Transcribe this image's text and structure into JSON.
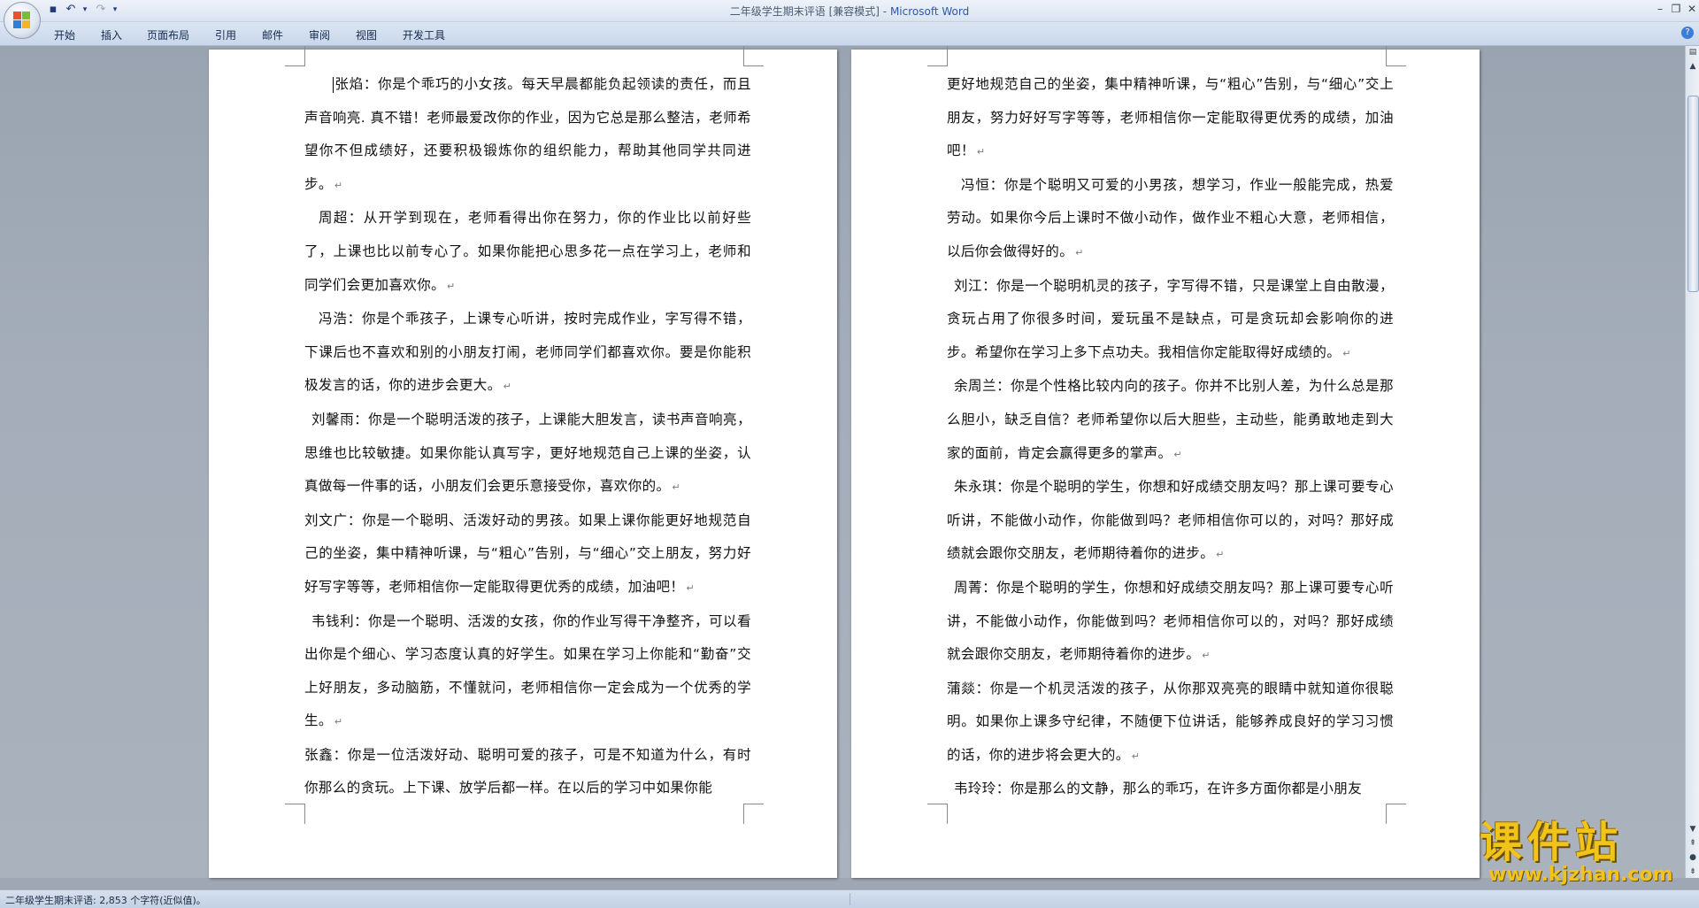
{
  "window": {
    "title": "二年级学生期末评语 [兼容模式]",
    "separator": " - ",
    "app": "Microsoft Word"
  },
  "ribbon": {
    "tabs": [
      "开始",
      "插入",
      "页面布局",
      "引用",
      "邮件",
      "审阅",
      "视图",
      "开发工具"
    ]
  },
  "document": {
    "left_page": [
      "张焰：你是个乖巧的小女孩。每天早晨都能负起领读的责任，而且声音响亮. 真不错！老师最爱改你的作业，因为它总是那么整洁，老师希望你不但成绩好，还要积极锻炼你的组织能力，帮助其他同学共同进步。",
      "周超：从开学到现在，老师看得出你在努力，你的作业比以前好些了，上课也比以前专心了。如果你能把心思多花一点在学习上，老师和同学们会更加喜欢你。",
      "冯浩：你是个乖孩子，上课专心听讲，按时完成作业，字写得不错，下课后也不喜欢和别的小朋友打闹，老师同学们都喜欢你。要是你能积极发言的话，你的进步会更大。",
      "刘馨雨：你是一个聪明活泼的孩子，上课能大胆发言，读书声音响亮，思维也比较敏捷。如果你能认真写字，更好地规范自己上课的坐姿，认真做每一件事的话，小朋友们会更乐意接受你，喜欢你的。",
      "刘文广：你是一个聪明、活泼好动的男孩。如果上课你能更好地规范自己的坐姿，集中精神听课，与“粗心”告别，与“细心”交上朋友，努力好好写字等等，老师相信你一定能取得更优秀的成绩，加油吧！",
      "韦钱利：你是一个聪明、活泼的女孩，你的作业写得干净整齐，可以看出你是个细心、学习态度认真的好学生。如果在学习上你能和“勤奋”交上好朋友，多动脑筋，不懂就问，老师相信你一定会成为一个优秀的学生。",
      "张鑫：你是一位活泼好动、聪明可爱的孩子，可是不知道为什么，有时你那么的贪玩。上下课、放学后都一样。在以后的学习中如果你能"
    ],
    "right_page": [
      "更好地规范自己的坐姿，集中精神听课，与“粗心”告别，与“细心”交上朋友，努力好好写字等等，老师相信你一定能取得更优秀的成绩，加油吧！",
      "冯恒：你是个聪明又可爱的小男孩，想学习，作业一般能完成，热爱劳动。如果你今后上课时不做小动作，做作业不粗心大意，老师相信，以后你会做得好的。",
      "刘江：你是一个聪明机灵的孩子，字写得不错，只是课堂上自由散漫，贪玩占用了你很多时间，爱玩虽不是缺点，可是贪玩却会影响你的进步。希望你在学习上多下点功夫。我相信你定能取得好成绩的。",
      "余周兰：你是个性格比较内向的孩子。你并不比别人差，为什么总是那么胆小，缺乏自信？老师希望你以后大胆些，主动些，能勇敢地走到大家的面前，肯定会赢得更多的掌声。",
      "朱永琪：你是个聪明的学生，你想和好成绩交朋友吗？那上课可要专心听讲，不能做小动作，你能做到吗？老师相信你可以的，对吗？那好成绩就会跟你交朋友，老师期待着你的进步。",
      "周菁：你是个聪明的学生，你想和好成绩交朋友吗？那上课可要专心听讲，不能做小动作，你能做到吗？老师相信你可以的，对吗？那好成绩就会跟你交朋友，老师期待着你的进步。",
      "蒲燚：你是一个机灵活泼的孩子，从你那双亮亮的眼睛中就知道你很聪明。如果你上课多守纪律，不随便下位讲话，能够养成良好的学习习惯的话，你的进步将会更大的。",
      "韦玲玲：你是那么的文静，那么的乖巧，在许多方面你都是小朋友"
    ],
    "paragraph_mark": "↵"
  },
  "status": {
    "text": "二年级学生期末评语: 2,853 个字符(近似值)。"
  },
  "watermark": {
    "big": "课件站",
    "small": "www.kjzhan.com"
  },
  "colors": {
    "workspace": "#9ea7b3",
    "ribbon": "#c9d7ea",
    "title_app": "#2a5aa8",
    "watermark": "#f0c419"
  }
}
